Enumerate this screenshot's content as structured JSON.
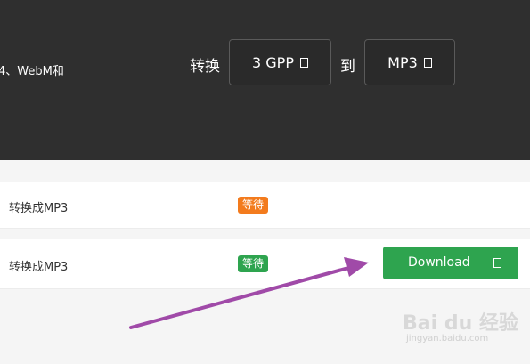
{
  "header": {
    "description": "4、WebM和",
    "convert_label": "转换",
    "to_label": "到",
    "from_format": "3 GPP",
    "to_format": "MP3"
  },
  "rows": [
    {
      "name": "转换成MP3",
      "status": "等待",
      "status_color": "#f37b1d"
    },
    {
      "name": "转换成MP3",
      "status": "等待",
      "status_color": "#2ea44f",
      "action": "Download",
      "action_color": "#2ea44f"
    }
  ],
  "icons": {
    "from_dropdown": "square-glyph-icon",
    "to_dropdown": "square-glyph-icon",
    "download": "square-glyph-icon"
  },
  "annotation": {
    "arrow_color": "#a04aa8"
  },
  "watermark": {
    "brand": "Bai du 经验",
    "url": "jingyan.baidu.com"
  }
}
